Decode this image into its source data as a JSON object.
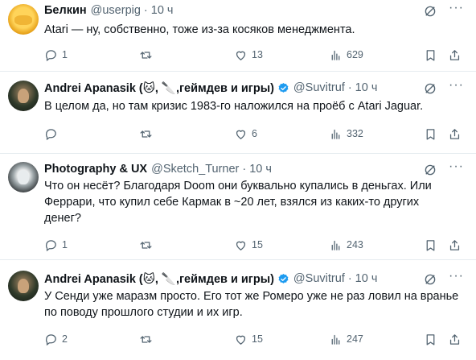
{
  "tweets": [
    {
      "name": "Белкин",
      "handle": "@userpig",
      "time": "10 ч",
      "verified": false,
      "text": [
        "Atari — ну, собственно, тоже из-за косяков менеджмента."
      ],
      "replies": "1",
      "retweets": "",
      "likes": "13",
      "views": "629"
    },
    {
      "name": "Andrei Apanasik (🐱, 🔪,геймдев и игры)",
      "handle": "@Suvitruf",
      "time": "10 ч",
      "verified": true,
      "text": [
        "В целом да, но там кризис 1983-го наложился на проёб с Atari Jaguar."
      ],
      "replies": "",
      "retweets": "",
      "likes": "6",
      "views": "332"
    },
    {
      "name": "Photography & UX",
      "handle": "@Sketch_Turner",
      "time": "10 ч",
      "verified": false,
      "text": [
        "Что он несёт? Благодаря Doom они буквально купались в деньгах. Или",
        "Феррари, что купил себе Кармак в ~20 лет, взялся из каких-то других",
        "денег?"
      ],
      "replies": "1",
      "retweets": "",
      "likes": "15",
      "views": "243"
    },
    {
      "name": "Andrei Apanasik (🐱, 🔪,геймдев и игры)",
      "handle": "@Suvitruf",
      "time": "10 ч",
      "verified": true,
      "text": [
        "У Сенди уже маразм просто. Его тот же Ромеро уже не раз ловил на вранье",
        "по поводу прошлого студии и их игр."
      ],
      "replies": "2",
      "retweets": "",
      "likes": "15",
      "views": "247"
    }
  ],
  "colors": {
    "text": "#0f1419",
    "secondary": "#536471",
    "verified": "#1d9bf0",
    "divider": "#e6ecf0"
  },
  "icons": [
    "reply-icon",
    "retweet-icon",
    "like-icon",
    "views-icon",
    "bookmark-icon",
    "share-icon",
    "grok-icon",
    "more-icon",
    "verified-badge-icon"
  ]
}
